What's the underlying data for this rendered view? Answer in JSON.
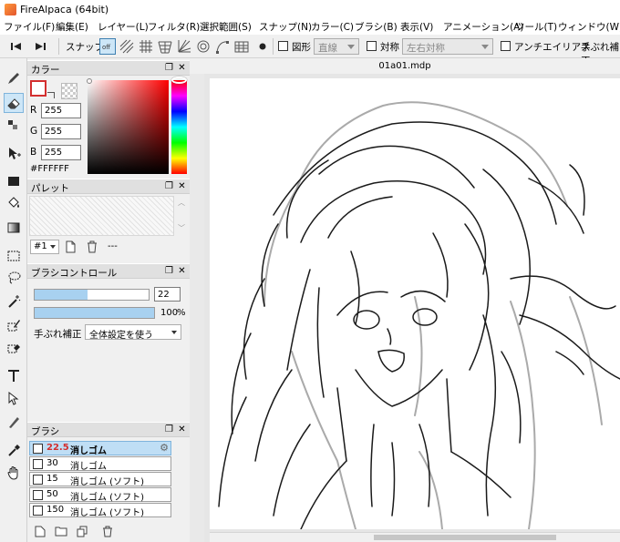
{
  "app": {
    "title": "FireAlpaca (64bit)"
  },
  "menu": [
    "ファイル(F)",
    "編集(E)",
    "レイヤー(L)",
    "フィルタ(R)",
    "選択範囲(S)",
    "スナップ(N)",
    "カラー(C)",
    "ブラシ(B)",
    "表示(V)",
    "アニメーション(A)",
    "ツール(T)",
    "ウィンドウ(W)"
  ],
  "toolbar": {
    "snap_label": "スナップ",
    "snap_off": "off",
    "shape_label": "図形",
    "shape_value": "直線",
    "symmetry_label": "対称",
    "symmetry_value": "左右対称",
    "antialias_label": "アンチエイリアス",
    "stabilizer_label": "手ぶれ補正"
  },
  "document": {
    "title": "01a01.mdp"
  },
  "color_panel": {
    "title": "カラー",
    "r_label": "R",
    "r": "255",
    "g_label": "G",
    "g": "255",
    "b_label": "B",
    "b": "255",
    "hex": "#FFFFFF",
    "primary_color": "#ffffff",
    "accent_border": "#d32f2f"
  },
  "palette_panel": {
    "title": "パレット",
    "palette_select": "#1",
    "palette_name": "---"
  },
  "brush_control_panel": {
    "title": "ブラシコントロール",
    "size": "22",
    "size_fraction": 0.46,
    "opacity": "100",
    "opacity_unit": "%",
    "opacity_fraction": 1.0,
    "stabilizer_label": "手ぶれ補正",
    "stabilizer_value": "全体設定を使う"
  },
  "brush_panel": {
    "title": "ブラシ",
    "items": [
      {
        "size": "22.5",
        "name": "消しゴム",
        "selected": true
      },
      {
        "size": "30",
        "name": "消しゴム",
        "selected": false
      },
      {
        "size": "15",
        "name": "消しゴム (ソフト)",
        "selected": false
      },
      {
        "size": "50",
        "name": "消しゴム (ソフト)",
        "selected": false
      },
      {
        "size": "150",
        "name": "消しゴム (ソフト)",
        "selected": false
      }
    ]
  },
  "colors": {
    "accent": "#3c7fb1",
    "selection": "#bfdef5",
    "slider_fill": "#a8d1f0"
  }
}
